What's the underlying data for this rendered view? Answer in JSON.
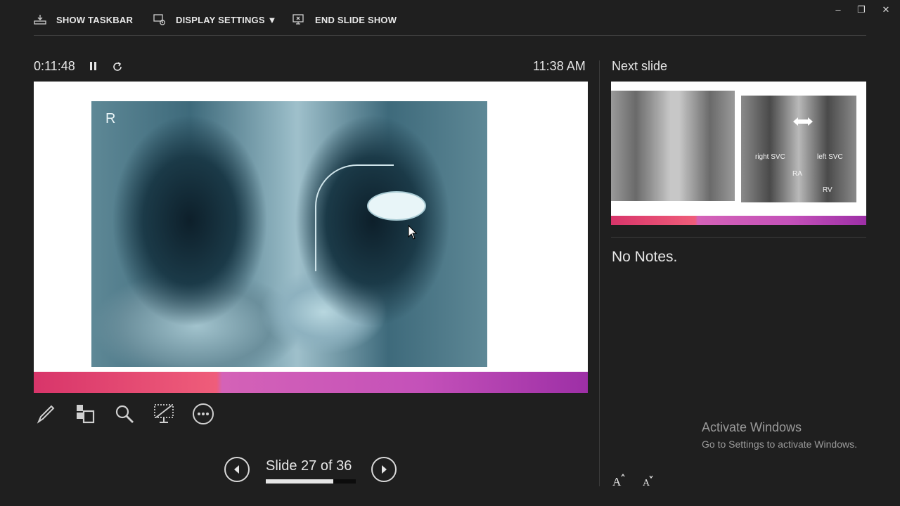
{
  "toolbar": {
    "show_taskbar": "SHOW TASKBAR",
    "display_settings": "DISPLAY SETTINGS ▼",
    "end_slide_show": "END SLIDE SHOW"
  },
  "window_controls": {
    "minimize": "–",
    "restore": "❐",
    "close": "✕"
  },
  "timer": "0:11:48",
  "clock": "11:38 AM",
  "slide": {
    "xray_marker": "R"
  },
  "navigation": {
    "slide_counter": "Slide 27 of 36",
    "progress": 0.75
  },
  "next_slide": {
    "label": "Next slide",
    "annotations": {
      "right_svc": "right SVC",
      "left_svc": "left SVC",
      "ra": "RA",
      "rv": "RV"
    }
  },
  "notes": "No Notes.",
  "watermark": {
    "title": "Activate Windows",
    "subtitle": "Go to Settings to activate Windows."
  },
  "colors": {
    "background": "#1f1f1f",
    "accent_start": "#d8356a",
    "accent_end": "#9d2fa6"
  }
}
